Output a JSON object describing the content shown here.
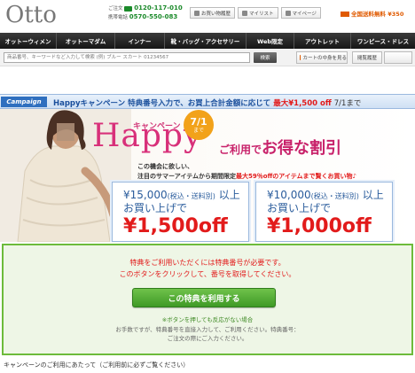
{
  "header": {
    "logo": "Otto",
    "phone_order_label": "ご注文",
    "phone_order": "0120-117-010",
    "phone_mobile_label": "携帯電話",
    "phone_mobile": "0570-550-083",
    "links": [
      "お買い物履歴",
      "マイリスト",
      "マイページ"
    ],
    "shipping": "全国送料無料 ¥350"
  },
  "nav": {
    "items": [
      "オットーウィメン",
      "オットーマダム",
      "インナー",
      "靴・バッグ・アクセサリー",
      "Web限定",
      "アウトレット",
      "ワンピース・ドレス"
    ]
  },
  "search": {
    "placeholder": "商品番号、キーワードなど入力して検索 (例) ブルー スカート 01234567",
    "button": "検索",
    "cart": "カートの中身を見る",
    "misc": "閲覧履歴"
  },
  "campaign_strip": {
    "tag": "Campaign",
    "text_main": "Happyキャンペーン 特典番号入力で、お買上合計金額に応じて",
    "text_highlight": "最大¥1,500 off",
    "text_end": "7/1まで"
  },
  "banner": {
    "happy_label": "キャンペーン",
    "happy": "Happy",
    "date_main": "7/1",
    "date_unit": "まで",
    "headline_pre": "ご利用で",
    "headline_big": "お得な割引",
    "subcopy_1": "この機会に欲しい、",
    "subcopy_2a": "注目のサマーアイテムから期間限定",
    "subcopy_2b": "最大59％offのアイテムまで賢くお買い物♪",
    "offers": [
      {
        "line1": "¥15,000",
        "tax": "(税込・送料別)",
        "line1_end": "以上",
        "line2": "お買い上げで",
        "amount": "¥1,500off"
      },
      {
        "line1": "¥10,000",
        "tax": "(税込・送料別)",
        "line1_end": "以上",
        "line2": "お買い上げで",
        "amount": "¥1,000off"
      }
    ]
  },
  "notice": {
    "line1": "特典をご利用いただくには特典番号が必要です。",
    "line2": "このボタンをクリックして、番号を取得してください。",
    "button": "この特典を利用する",
    "note_title": "※ボタンを押しても反応がない場合",
    "note_1": "お手数ですが、特典番号を直接入力して、ご利用ください。特典番号：",
    "note_2": "ご注文の際にご入力ください。"
  },
  "footer": {
    "text": "キャンペーンのご利用にあたって（ご利用前に必ずご覧ください）"
  }
}
